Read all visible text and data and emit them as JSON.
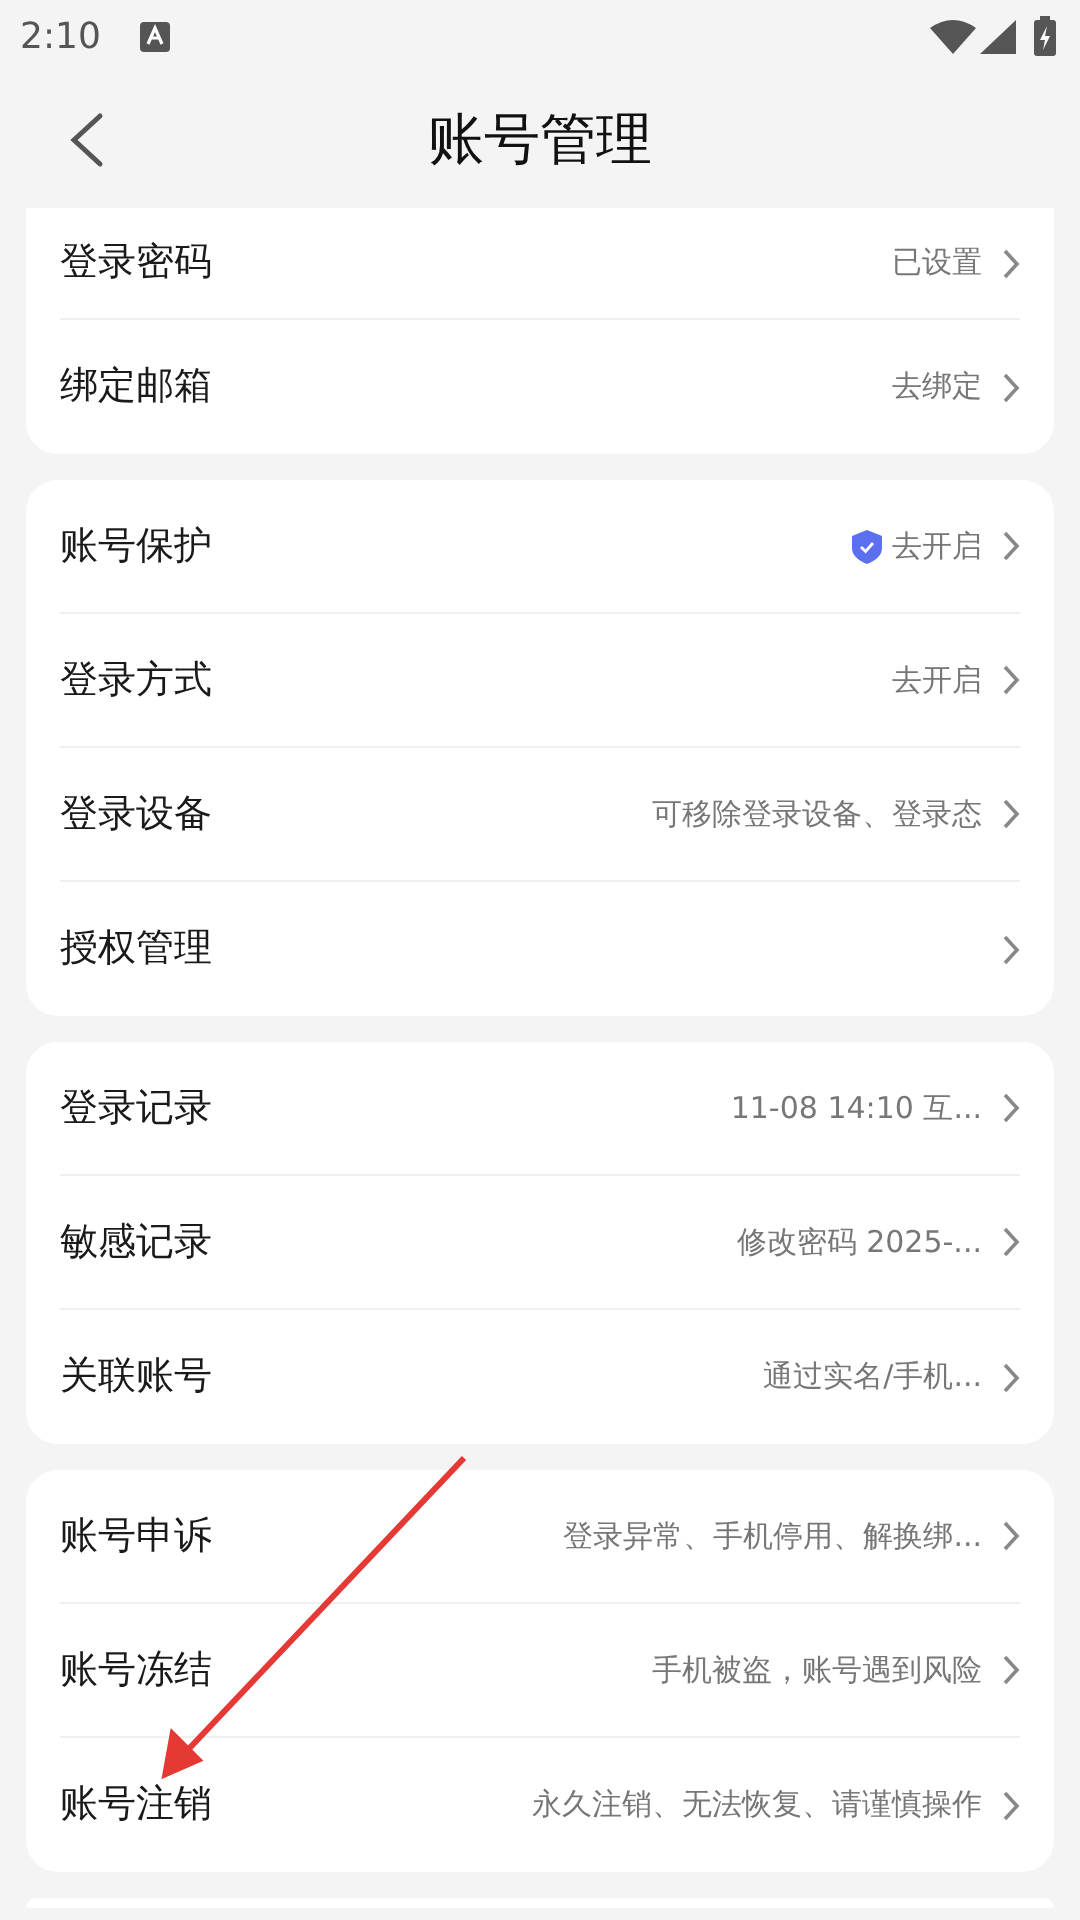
{
  "status_bar": {
    "time": "2:10"
  },
  "header": {
    "title": "账号管理"
  },
  "groups": [
    {
      "kind": "clipped_top",
      "rows": [
        {
          "label": "登录密码",
          "value": "已设置"
        },
        {
          "label": "绑定邮箱",
          "value": "去绑定"
        }
      ]
    },
    {
      "kind": "card",
      "rows": [
        {
          "label": "账号保护",
          "value": "去开启",
          "shield": true
        },
        {
          "label": "登录方式",
          "value": "去开启"
        },
        {
          "label": "登录设备",
          "value": "可移除登录设备、登录态"
        },
        {
          "label": "授权管理"
        }
      ]
    },
    {
      "kind": "card",
      "rows": [
        {
          "label": "登录记录",
          "value": "11-08 14:10 互..."
        },
        {
          "label": "敏感记录",
          "value": "修改密码 2025-..."
        },
        {
          "label": "关联账号",
          "value": "通过实名/手机..."
        }
      ]
    },
    {
      "kind": "card",
      "rows": [
        {
          "label": "账号申诉",
          "value": "登录异常、手机停用、解换绑..."
        },
        {
          "label": "账号冻结",
          "value": "手机被盗，账号遇到风险"
        },
        {
          "label": "账号注销",
          "value": "永久注销、无法恢复、请谨慎操作"
        }
      ]
    },
    {
      "kind": "clipped_bottom"
    }
  ],
  "annotation": {
    "kind": "arrow"
  }
}
